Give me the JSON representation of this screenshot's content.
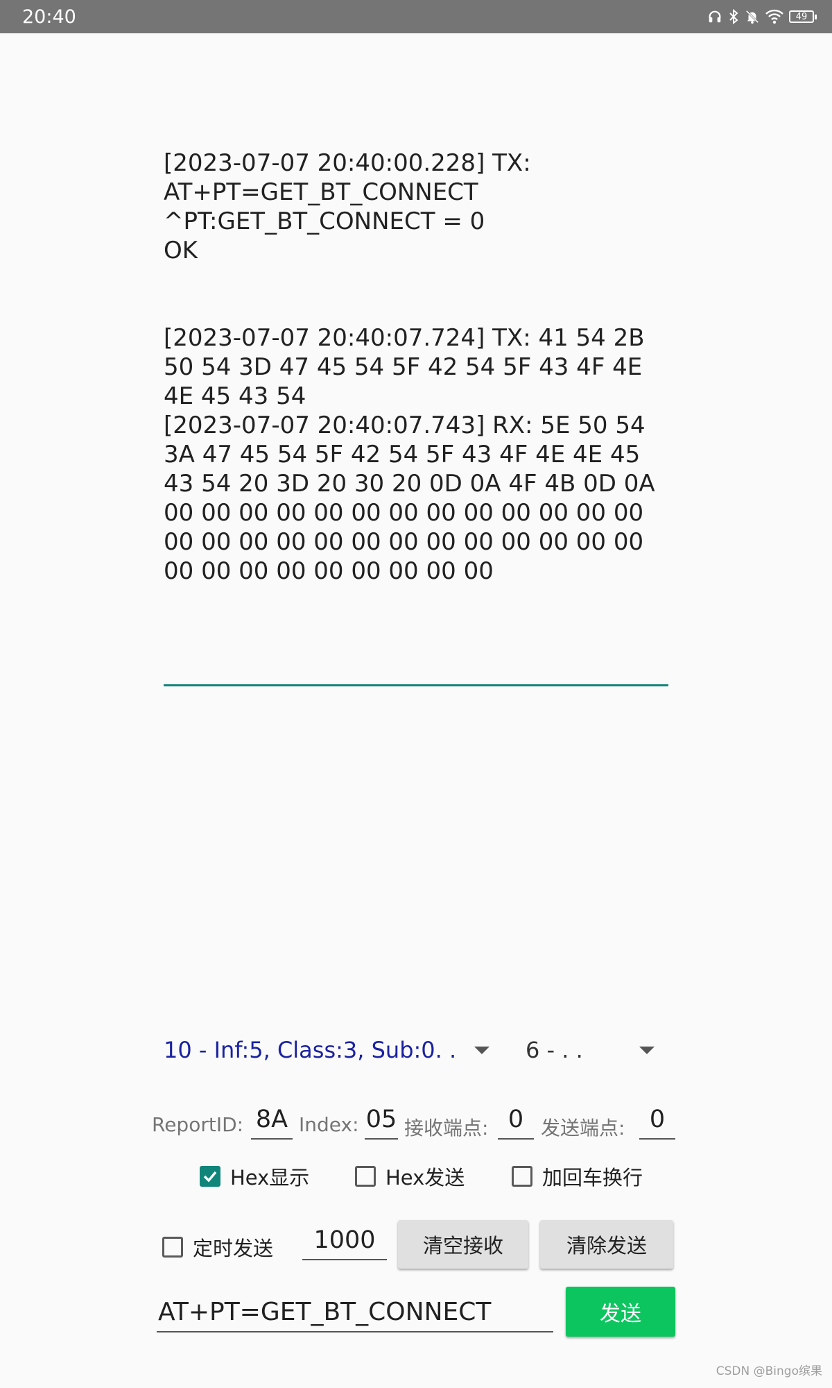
{
  "status_bar": {
    "time": "20:40",
    "battery": "49",
    "icons": [
      "headphones-icon",
      "bluetooth-icon",
      "notifications-off-icon",
      "wifi-icon",
      "battery-icon"
    ]
  },
  "log": {
    "lines": [
      "[2023-07-07 20:40:00.228] TX:",
      "AT+PT=GET_BT_CONNECT",
      "^PT:GET_BT_CONNECT = 0",
      "OK",
      "",
      "",
      "[2023-07-07 20:40:07.724] TX: 41 54 2B 50 54 3D 47 45 54 5F 42 54 5F 43 4F 4E 4E 45 43 54",
      "[2023-07-07 20:40:07.743] RX: 5E 50 54 3A 47 45 54 5F 42 54 5F 43 4F 4E 4E 45 43 54 20 3D 20 30 20 0D 0A 4F 4B 0D 0A 00 00 00 00 00 00 00 00 00 00 00 00 00 00 00 00 00 00 00 00 00 00 00 00 00 00 00 00 00 00 00 00 00 00 00"
    ]
  },
  "spinners": {
    "interface": "10 - Inf:5, Class:3, Sub:0. .",
    "endpoint": "6 - . ."
  },
  "params": {
    "report_id_label": "ReportID:",
    "report_id_value": "8A",
    "index_label": "Index:",
    "index_value": "05",
    "recv_endpoint_label": "接收端点:",
    "recv_endpoint_value": "0",
    "send_endpoint_label": "发送端点:",
    "send_endpoint_value": "0"
  },
  "options": {
    "hex_display": {
      "label": "Hex显示",
      "checked": true
    },
    "hex_send": {
      "label": "Hex发送",
      "checked": false
    },
    "crlf": {
      "label": "加回车换行",
      "checked": false
    }
  },
  "operations": {
    "timed_send_label": "定时发送",
    "timed_send_checked": false,
    "interval_value": "1000",
    "clear_receive_label": "清空接收",
    "clear_send_label": "清除发送"
  },
  "send": {
    "command_value": "AT+PT=GET_BT_CONNECT",
    "send_label": "发送"
  },
  "colors": {
    "accent": "#11857a",
    "send_button": "#0dc55f",
    "spinner_text": "#1a22a0"
  },
  "watermark": "CSDN @Bingo缤果"
}
